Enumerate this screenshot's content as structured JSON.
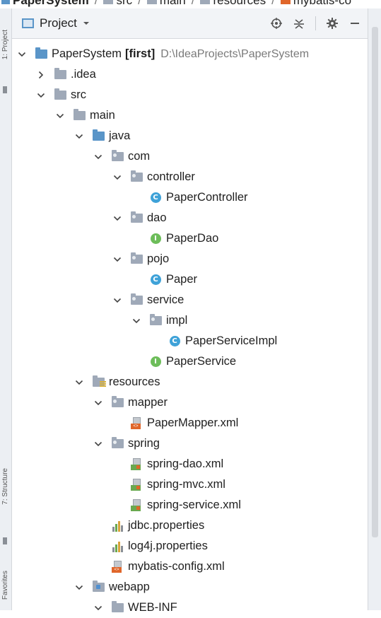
{
  "breadcrumb": [
    "PaperSystem",
    "src",
    "main",
    "resources",
    "mybatis-co"
  ],
  "left_strip": {
    "top_label": "1: Project",
    "mid_label": "7: Structure",
    "bottom_label": "Favorites"
  },
  "header": {
    "title": "Project"
  },
  "tree": [
    {
      "label": "PaperSystem",
      "extra": "[first]",
      "path": "D:\\IdeaProjects\\PaperSystem",
      "icon": "module-folder-icon",
      "chev": "down",
      "depth": 0
    },
    {
      "label": ".idea",
      "icon": "folder-icon",
      "chev": "right",
      "depth": 1
    },
    {
      "label": "src",
      "icon": "folder-icon",
      "chev": "down",
      "depth": 1
    },
    {
      "label": "main",
      "icon": "folder-icon",
      "chev": "down",
      "depth": 2
    },
    {
      "label": "java",
      "icon": "source-folder-icon",
      "chev": "down",
      "depth": 3
    },
    {
      "label": "com",
      "icon": "package-icon",
      "chev": "down",
      "depth": 4
    },
    {
      "label": "controller",
      "icon": "package-icon",
      "chev": "down",
      "depth": 5
    },
    {
      "label": "PaperController",
      "icon": "class-icon",
      "chev": "",
      "depth": 6
    },
    {
      "label": "dao",
      "icon": "package-icon",
      "chev": "down",
      "depth": 5
    },
    {
      "label": "PaperDao",
      "icon": "interface-icon",
      "chev": "",
      "depth": 6
    },
    {
      "label": "pojo",
      "icon": "package-icon",
      "chev": "down",
      "depth": 5
    },
    {
      "label": "Paper",
      "icon": "class-icon",
      "chev": "",
      "depth": 6
    },
    {
      "label": "service",
      "icon": "package-icon",
      "chev": "down",
      "depth": 5
    },
    {
      "label": "impl",
      "icon": "package-icon",
      "chev": "down",
      "depth": 6
    },
    {
      "label": "PaperServiceImpl",
      "icon": "class-icon",
      "chev": "",
      "depth": 7
    },
    {
      "label": "PaperService",
      "icon": "interface-icon",
      "chev": "",
      "depth": 6
    },
    {
      "label": "resources",
      "icon": "resources-folder-icon",
      "chev": "down",
      "depth": 3
    },
    {
      "label": "mapper",
      "icon": "package-icon",
      "chev": "down",
      "depth": 4
    },
    {
      "label": "PaperMapper.xml",
      "icon": "xml-file-icon",
      "chev": "",
      "depth": 5
    },
    {
      "label": "spring",
      "icon": "package-icon",
      "chev": "down",
      "depth": 4
    },
    {
      "label": "spring-dao.xml",
      "icon": "spring-xml-icon",
      "chev": "",
      "depth": 5
    },
    {
      "label": "spring-mvc.xml",
      "icon": "spring-xml-icon",
      "chev": "",
      "depth": 5
    },
    {
      "label": "spring-service.xml",
      "icon": "spring-xml-icon",
      "chev": "",
      "depth": 5
    },
    {
      "label": "jdbc.properties",
      "icon": "properties-file-icon",
      "chev": "",
      "depth": 4
    },
    {
      "label": "log4j.properties",
      "icon": "properties-file-icon",
      "chev": "",
      "depth": 4
    },
    {
      "label": "mybatis-config.xml",
      "icon": "xml-file-icon",
      "chev": "",
      "depth": 4
    },
    {
      "label": "webapp",
      "icon": "web-folder-icon",
      "chev": "down",
      "depth": 3
    },
    {
      "label": "WEB-INF",
      "icon": "folder-icon",
      "chev": "down",
      "depth": 4
    }
  ]
}
